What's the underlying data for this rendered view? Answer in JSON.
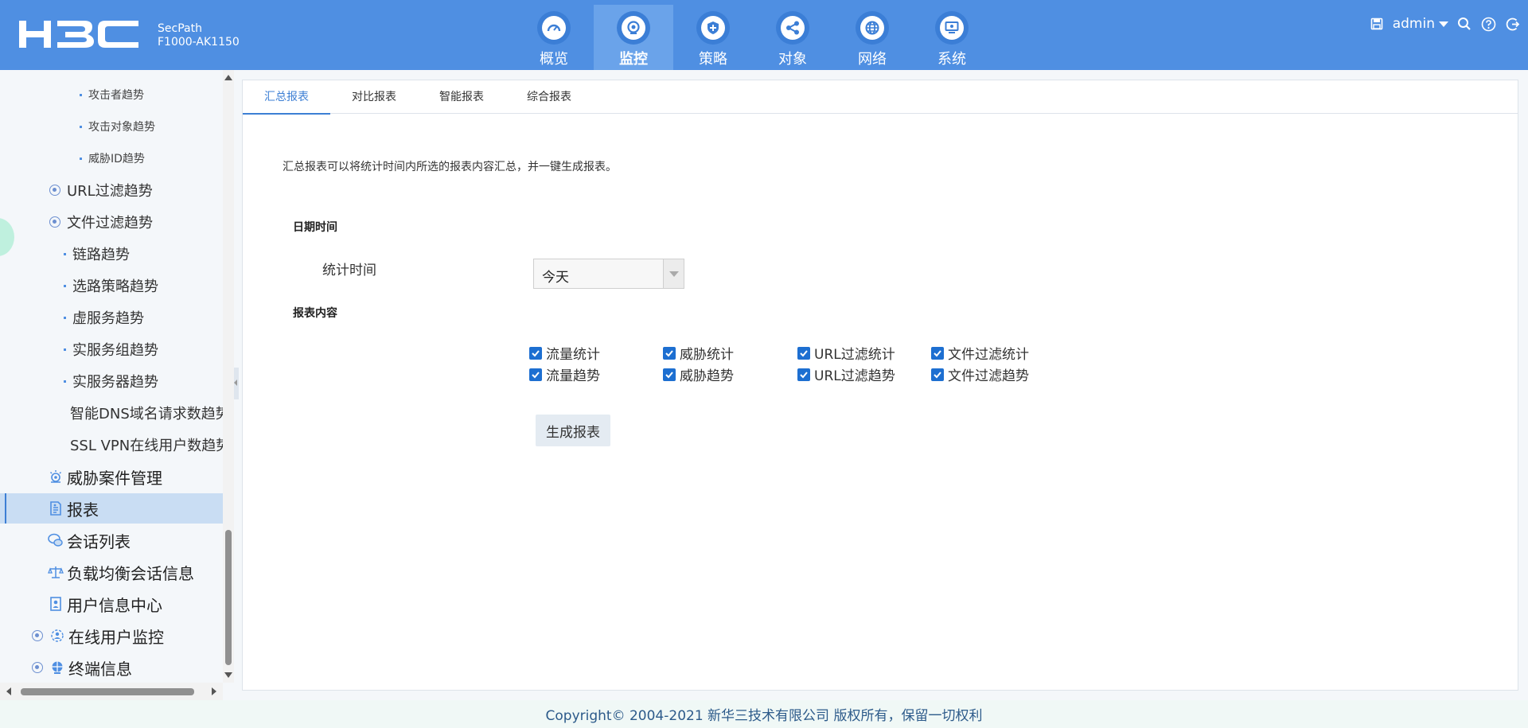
{
  "header": {
    "brand": "H3C",
    "product_line1": "SecPath",
    "product_line2": "F1000-AK1150",
    "nav": [
      {
        "label": "概览",
        "icon": "gauge-icon"
      },
      {
        "label": "监控",
        "icon": "monitor-camera-icon",
        "active": true
      },
      {
        "label": "策略",
        "icon": "shield-icon"
      },
      {
        "label": "对象",
        "icon": "share-nodes-icon"
      },
      {
        "label": "网络",
        "icon": "globe-icon"
      },
      {
        "label": "系统",
        "icon": "system-screen-icon"
      }
    ],
    "user": "admin"
  },
  "sidebar": {
    "items": [
      {
        "label": "攻击者趋势"
      },
      {
        "label": "攻击对象趋势"
      },
      {
        "label": "威胁ID趋势"
      },
      {
        "label": "URL过滤趋势"
      },
      {
        "label": "文件过滤趋势"
      },
      {
        "label": "链路趋势"
      },
      {
        "label": "选路策略趋势"
      },
      {
        "label": "虚服务趋势"
      },
      {
        "label": "实服务组趋势"
      },
      {
        "label": "实服务器趋势"
      },
      {
        "label": "智能DNS域名请求数趋势"
      },
      {
        "label": "SSL VPN在线用户数趋势"
      },
      {
        "label": "威胁案件管理"
      },
      {
        "label": "报表",
        "active": true
      },
      {
        "label": "会话列表"
      },
      {
        "label": "负载均衡会话信息"
      },
      {
        "label": "用户信息中心"
      },
      {
        "label": "在线用户监控"
      },
      {
        "label": "终端信息"
      }
    ]
  },
  "tabs": [
    {
      "label": "汇总报表",
      "active": true
    },
    {
      "label": "对比报表"
    },
    {
      "label": "智能报表"
    },
    {
      "label": "综合报表"
    }
  ],
  "content": {
    "description": "汇总报表可以将统计时间内所选的报表内容汇总，并一键生成报表。",
    "date_section": "日期时间",
    "stat_time_label": "统计时间",
    "stat_time_value": "今天",
    "report_section": "报表内容",
    "checkboxes": [
      {
        "label": "流量统计",
        "checked": true
      },
      {
        "label": "威胁统计",
        "checked": true
      },
      {
        "label": "URL过滤统计",
        "checked": true
      },
      {
        "label": "文件过滤统计",
        "checked": true
      },
      {
        "label": "流量趋势",
        "checked": true
      },
      {
        "label": "威胁趋势",
        "checked": true
      },
      {
        "label": "URL过滤趋势",
        "checked": true
      },
      {
        "label": "文件过滤趋势",
        "checked": true
      }
    ],
    "generate_button": "生成报表"
  },
  "footer": {
    "copyright": "Copyright© 2004-2021 新华三技术有限公司 版权所有，保留一切权利"
  },
  "colors": {
    "header_bg": "#4f8fe2",
    "accent": "#3d7fd4",
    "checkbox": "#1d6fd1"
  }
}
